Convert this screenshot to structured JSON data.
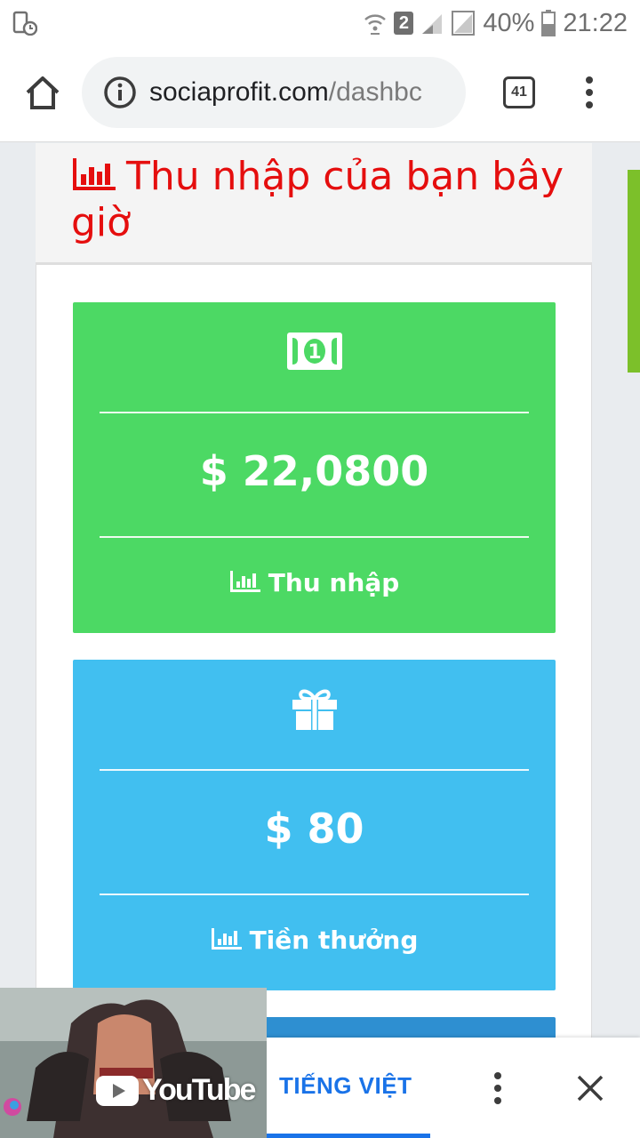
{
  "status_bar": {
    "left_icon": "phone-clock-icon",
    "sim_badge": "2",
    "battery_percent": "40%",
    "time": "21:22"
  },
  "browser": {
    "url_domain": "sociaprofit.com",
    "url_path": "/dashbc",
    "tab_count": "41"
  },
  "page": {
    "heading": "Thu nhập của bạn bây giờ",
    "cards": [
      {
        "icon": "money-bill-icon",
        "amount": "$ 22,0800",
        "label": "Thu nhập",
        "color": "#4cd964"
      },
      {
        "icon": "gift-icon",
        "amount": "$ 80",
        "label": "Tiền thưởng",
        "color": "#41bff0"
      }
    ]
  },
  "bottom_banner": {
    "video_logo": "YouTube",
    "language_tab": "TIẾNG VIỆT"
  },
  "colors": {
    "heading_red": "#e50e0e",
    "accent_blue": "#1a73e8"
  }
}
